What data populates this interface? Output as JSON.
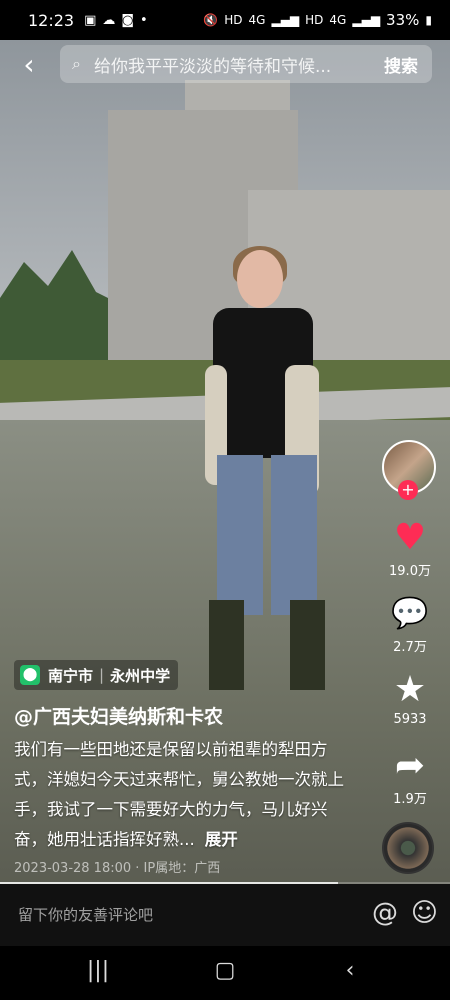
{
  "status_bar": {
    "time": "12:23",
    "icons_left": [
      "gallery-icon",
      "cloud-icon",
      "app-icon",
      "dot-icon"
    ],
    "network_labels": [
      "HD",
      "4G",
      "HD",
      "4G"
    ],
    "battery": "33%"
  },
  "search": {
    "placeholder": "给你我平平淡淡的等待和守候...",
    "button": "搜索"
  },
  "actions": {
    "likes": "19.0万",
    "comments": "2.7万",
    "favorites": "5933",
    "shares": "1.9万"
  },
  "location": {
    "city": "南宁市",
    "place": "永州中学"
  },
  "author": "@广西夫妇美纳斯和卡农",
  "description": "我们有一些田地还是保留以前祖辈的犁田方式，洋媳妇今天过来帮忙，舅公教她一次就上手，我试了一下需要好大的力气，马儿好兴奋，她用壮话指挥好熟...",
  "expand_label": "展开",
  "date_location": "2023-03-28 18:00 · IP属地：广西",
  "progress": 0.75,
  "comment_bar": {
    "placeholder": "留下你的友善评论吧"
  },
  "colors": {
    "like": "#fe2c55",
    "location_pin": "#22c06a"
  }
}
